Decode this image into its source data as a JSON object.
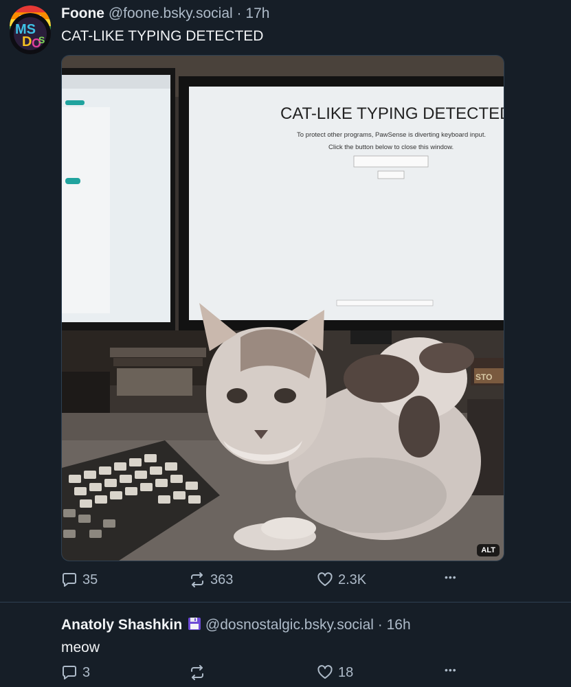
{
  "post1": {
    "author_name": "Foone",
    "handle": "@foone.bsky.social",
    "separator": "·",
    "time": "17h",
    "text": "CAT-LIKE TYPING DETECTED",
    "image": {
      "alt_badge": "ALT",
      "screen_title": "CAT-LIKE TYPING DETECTED",
      "screen_line1": "To protect other programs, PawSense is diverting keyboard input.",
      "screen_line2": "Click the button below to close this window.",
      "box_sign": "STO"
    },
    "replies": "35",
    "reposts": "363",
    "likes": "2.3K",
    "more": "•••"
  },
  "post2": {
    "author_name": "Anatoly Shashkin",
    "handle": "@dosnostalgic.bsky.social",
    "separator": "·",
    "time": "16h",
    "text": "meow",
    "replies": "3",
    "reposts": "",
    "likes": "18",
    "more": "•••"
  },
  "colors": {
    "background": "#161e27",
    "text": "#f1f3f5",
    "muted": "#aebbc9",
    "border": "#2e4052"
  },
  "icons": [
    "reply-icon",
    "repost-icon",
    "like-icon",
    "more-icon",
    "floppy-disk-icon"
  ]
}
